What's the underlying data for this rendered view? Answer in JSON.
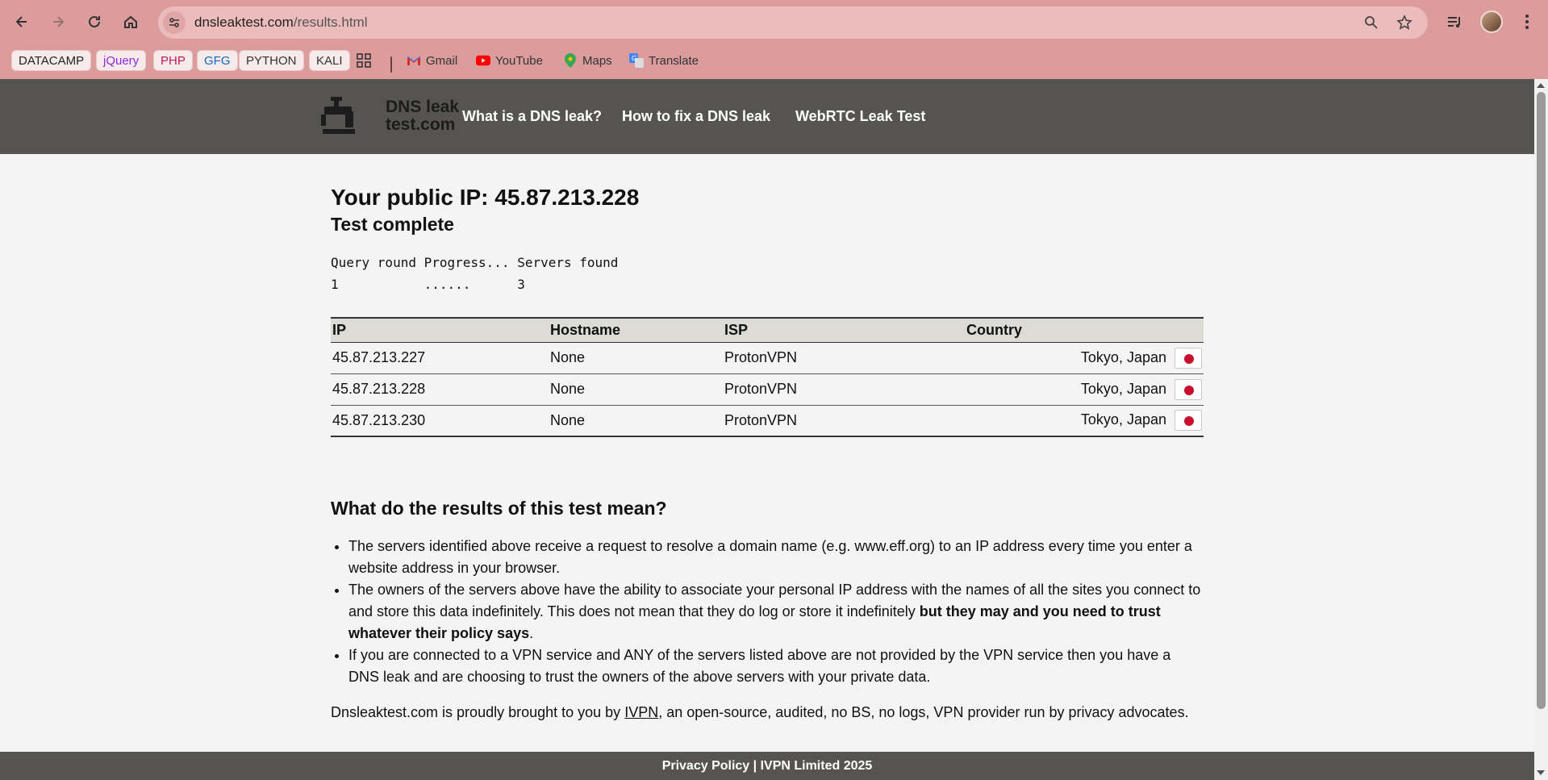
{
  "browser": {
    "url_host": "dnsleaktest.com",
    "url_path": "/results.html",
    "bookmarks": [
      {
        "label": "DATACAMP",
        "color": "#222222"
      },
      {
        "label": "jQuery",
        "color": "#8a2be2"
      },
      {
        "label": "PHP",
        "color": "#c2185b"
      },
      {
        "label": "GFG",
        "color": "#1565c0"
      },
      {
        "label": "PYTHON",
        "color": "#333333"
      },
      {
        "label": "KALI",
        "color": "#333333"
      },
      {
        "label": "Gmail"
      },
      {
        "label": "YouTube"
      },
      {
        "label": "Maps"
      },
      {
        "label": "Translate"
      }
    ]
  },
  "site": {
    "logo_line1": "DNS leak",
    "logo_line2": "test.com",
    "nav": [
      "What is a DNS leak?",
      "How to fix a DNS leak",
      "WebRTC Leak Test"
    ]
  },
  "result": {
    "public_ip": "Your public IP: 45.87.213.228",
    "status": "Test complete",
    "progress_header": "Query round Progress... Servers found",
    "progress_row": "1           ......      3"
  },
  "table": {
    "headers": [
      "IP",
      "Hostname",
      "ISP",
      "Country"
    ],
    "rows": [
      {
        "ip": "45.87.213.227",
        "hostname": "None",
        "isp": "ProtonVPN",
        "country": "Tokyo, Japan"
      },
      {
        "ip": "45.87.213.228",
        "hostname": "None",
        "isp": "ProtonVPN",
        "country": "Tokyo, Japan"
      },
      {
        "ip": "45.87.213.230",
        "hostname": "None",
        "isp": "ProtonVPN",
        "country": "Tokyo, Japan"
      }
    ]
  },
  "explain": {
    "title": "What do the results of this test mean?",
    "bullet1": "The servers identified above receive a request to resolve a domain name (e.g. www.eff.org) to an IP address every time you enter a website address in your browser.",
    "bullet2_plain": "The owners of the servers above have the ability to associate your personal IP address with the names of all the sites you connect to and store this data indefinitely. This does not mean that they do log or store it indefinitely ",
    "bullet2_bold": "but they may and you need to trust whatever their policy says",
    "bullet2_end": ".",
    "bullet3": "If you are connected to a VPN service and ANY of the servers listed above are not provided by the VPN service then you have a DNS leak and are choosing to trust the owners of the above servers with your private data.",
    "credit_pre": "Dnsleaktest.com is proudly brought to you by ",
    "credit_link": "IVPN",
    "credit_post": ", an open-source, audited, no BS, no logs, VPN provider run by privacy advocates."
  },
  "footer": {
    "text": "Privacy Policy | IVPN Limited 2025"
  }
}
